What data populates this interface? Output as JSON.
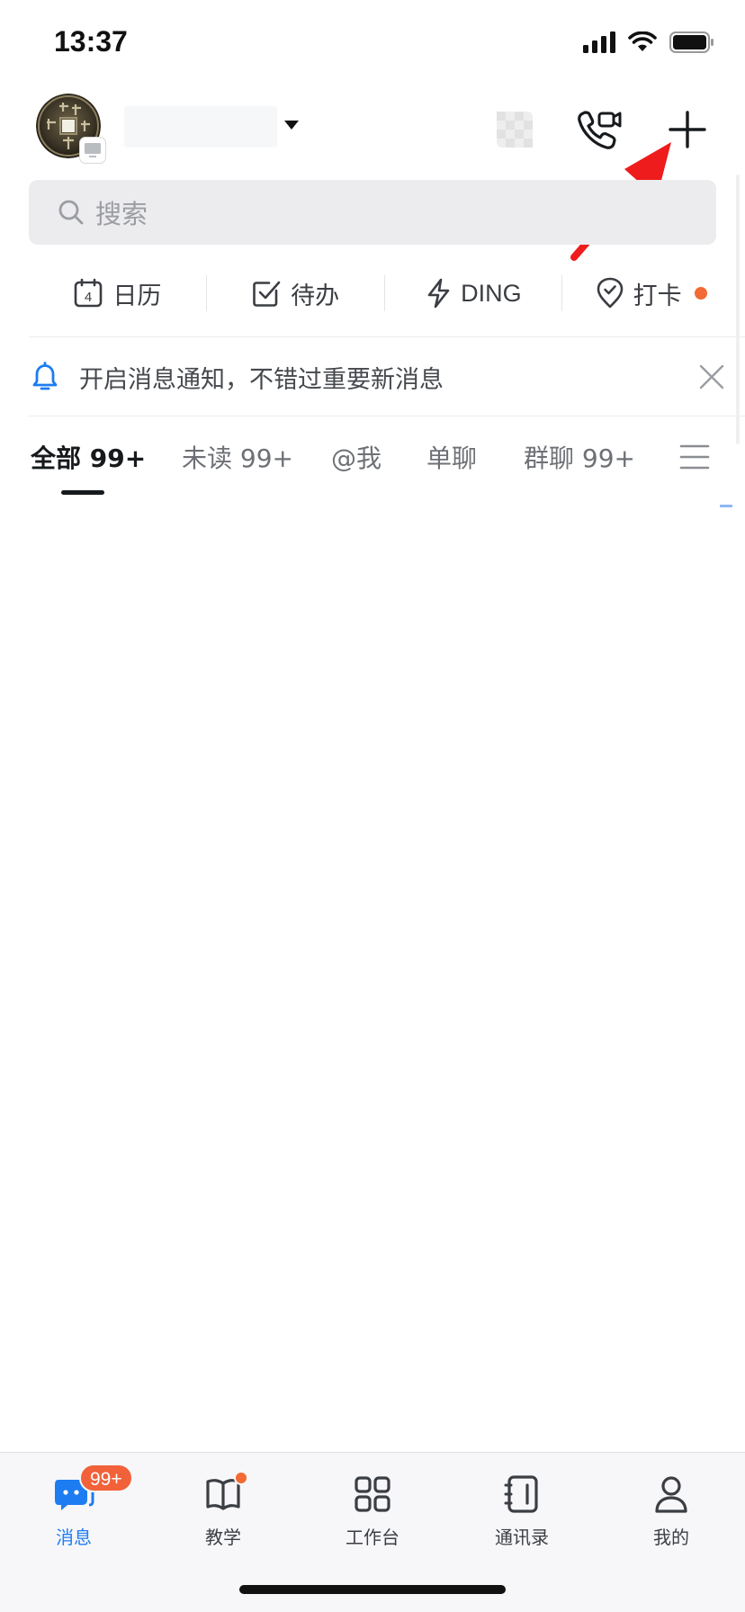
{
  "status_bar": {
    "time": "13:37"
  },
  "search": {
    "placeholder": "搜索"
  },
  "quick_actions": [
    {
      "label": "日历",
      "icon": "calendar-icon",
      "day": "4"
    },
    {
      "label": "待办",
      "icon": "todo-check-icon"
    },
    {
      "label": "DING",
      "icon": "lightning-icon"
    },
    {
      "label": "打卡",
      "icon": "location-check-icon",
      "has_dot": true
    }
  ],
  "notice": {
    "text": "开启消息通知，不错过重要新消息"
  },
  "tabs": [
    {
      "label": "全部 99+",
      "active": true
    },
    {
      "label": "未读 99+"
    },
    {
      "label": "@我"
    },
    {
      "label": "单聊"
    },
    {
      "label": "群聊 99+"
    }
  ],
  "tabbar": [
    {
      "label": "消息",
      "icon": "message-icon",
      "active": true,
      "badge": "99+"
    },
    {
      "label": "教学",
      "icon": "book-icon",
      "dot": true
    },
    {
      "label": "工作台",
      "icon": "grid-icon"
    },
    {
      "label": "通讯录",
      "icon": "contacts-icon"
    },
    {
      "label": "我的",
      "icon": "profile-icon"
    }
  ],
  "colors": {
    "accent": "#1d7cf2",
    "badge": "#f1613a",
    "annotation": "#ee1c1c"
  }
}
